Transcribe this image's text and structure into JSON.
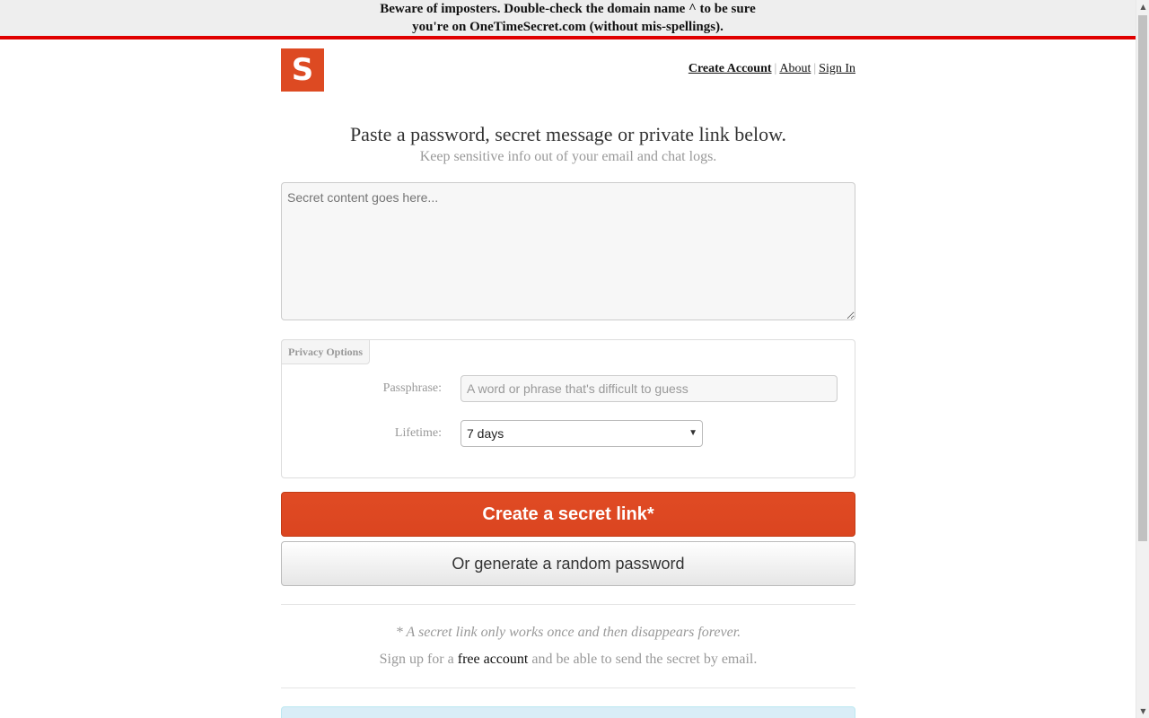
{
  "notice": {
    "line1": "Beware of imposters. Double-check the domain name ^ to be sure",
    "line2": "you're on OneTimeSecret.com (without mis-spellings)."
  },
  "header": {
    "logo_letter": "S",
    "nav": [
      {
        "label": "Create Account"
      },
      {
        "label": "About"
      },
      {
        "label": "Sign In"
      }
    ]
  },
  "main": {
    "headline": "Paste a password, secret message or private link below.",
    "subline": "Keep sensitive info out of your email and chat logs.",
    "secret_placeholder": "Secret content goes here...",
    "privacy": {
      "tab_label": "Privacy Options",
      "passphrase_label": "Passphrase:",
      "passphrase_placeholder": "A word or phrase that's difficult to guess",
      "lifetime_label": "Lifetime:",
      "lifetime_value": "7 days"
    },
    "create_button": "Create a secret link*",
    "generate_button": "Or generate a random password",
    "footnote": "* A secret link only works once and then disappears forever.",
    "signup_prefix": "Sign up for a",
    "signup_link": "free account",
    "signup_suffix": "and be able to send the secret by email."
  },
  "colors": {
    "accent": "#dd4a22",
    "notice_border": "#e00000",
    "alert_bg": "#d9edf7"
  }
}
